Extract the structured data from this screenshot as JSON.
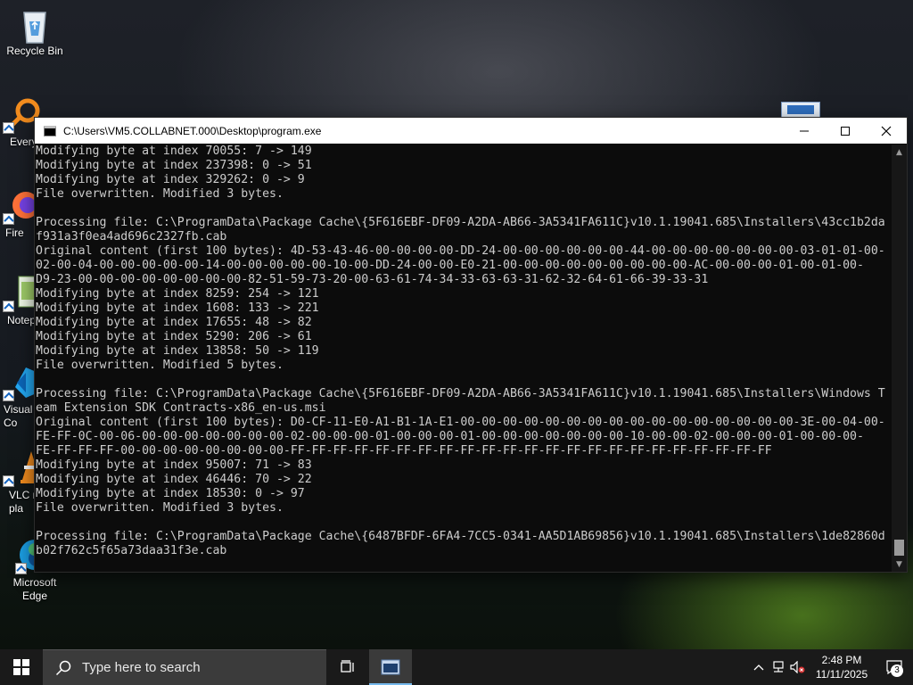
{
  "desktop": {
    "icons": [
      {
        "label": "Recycle Bin",
        "icon": "recycle-bin-icon"
      },
      {
        "label": "Every",
        "icon": "everything-icon"
      },
      {
        "label": "Fire",
        "icon": "firefox-icon"
      },
      {
        "label": "Notep",
        "icon": "notepad-icon"
      },
      {
        "label": "Visual\nCo",
        "icon": "vscode-icon"
      },
      {
        "label": "VLC m\npla",
        "icon": "vlc-icon"
      },
      {
        "label": "Microsoft\nEdge",
        "icon": "edge-icon"
      }
    ]
  },
  "console": {
    "title": "C:\\Users\\VM5.COLLABNET.000\\Desktop\\program.exe",
    "lines": [
      "Modifying byte at index 70055: 7 -> 149",
      "Modifying byte at index 237398: 0 -> 51",
      "Modifying byte at index 329262: 0 -> 9",
      "File overwritten. Modified 3 bytes.",
      "",
      "Processing file: C:\\ProgramData\\Package Cache\\{5F616EBF-DF09-A2DA-AB66-3A5341FA611C}v10.1.19041.685\\Installers\\43cc1b2da",
      "f931a3f0ea4ad696c2327fb.cab",
      "Original content (first 100 bytes): 4D-53-43-46-00-00-00-00-DD-24-00-00-00-00-00-00-44-00-00-00-00-00-00-00-03-01-01-00-",
      "02-00-04-00-00-00-00-00-14-00-00-00-00-00-10-00-DD-24-00-00-E0-21-00-00-00-00-00-00-00-00-00-AC-00-00-00-01-00-01-00-",
      "D9-23-00-00-00-00-00-00-00-00-82-51-59-73-20-00-63-61-74-34-33-63-63-31-62-32-64-61-66-39-33-31",
      "Modifying byte at index 8259: 254 -> 121",
      "Modifying byte at index 1608: 133 -> 221",
      "Modifying byte at index 17655: 48 -> 82",
      "Modifying byte at index 5290: 206 -> 61",
      "Modifying byte at index 13858: 50 -> 119",
      "File overwritten. Modified 5 bytes.",
      "",
      "Processing file: C:\\ProgramData\\Package Cache\\{5F616EBF-DF09-A2DA-AB66-3A5341FA611C}v10.1.19041.685\\Installers\\Windows T",
      "eam Extension SDK Contracts-x86_en-us.msi",
      "Original content (first 100 bytes): D0-CF-11-E0-A1-B1-1A-E1-00-00-00-00-00-00-00-00-00-00-00-00-00-00-00-00-3E-00-04-00-",
      "FE-FF-0C-00-06-00-00-00-00-00-00-00-02-00-00-00-01-00-00-00-01-00-00-00-00-00-00-00-10-00-00-02-00-00-00-01-00-00-00-",
      "FE-FF-FF-FF-00-00-00-00-00-00-00-00-FF-FF-FF-FF-FF-FF-FF-FF-FF-FF-FF-FF-FF-FF-FF-FF-FF-FF-FF-FF-FF-FF-FF",
      "Modifying byte at index 95007: 71 -> 83",
      "Modifying byte at index 46446: 70 -> 22",
      "Modifying byte at index 18530: 0 -> 97",
      "File overwritten. Modified 3 bytes.",
      "",
      "Processing file: C:\\ProgramData\\Package Cache\\{6487BFDF-6FA4-7CC5-0341-AA5D1AB69856}v10.1.19041.685\\Installers\\1de82860d",
      "b02f762c5f65a73daa31f3e.cab"
    ]
  },
  "taskbar": {
    "search_placeholder": "Type here to search",
    "time": "2:48 PM",
    "date": "11/11/2025",
    "notification_count": "3"
  }
}
